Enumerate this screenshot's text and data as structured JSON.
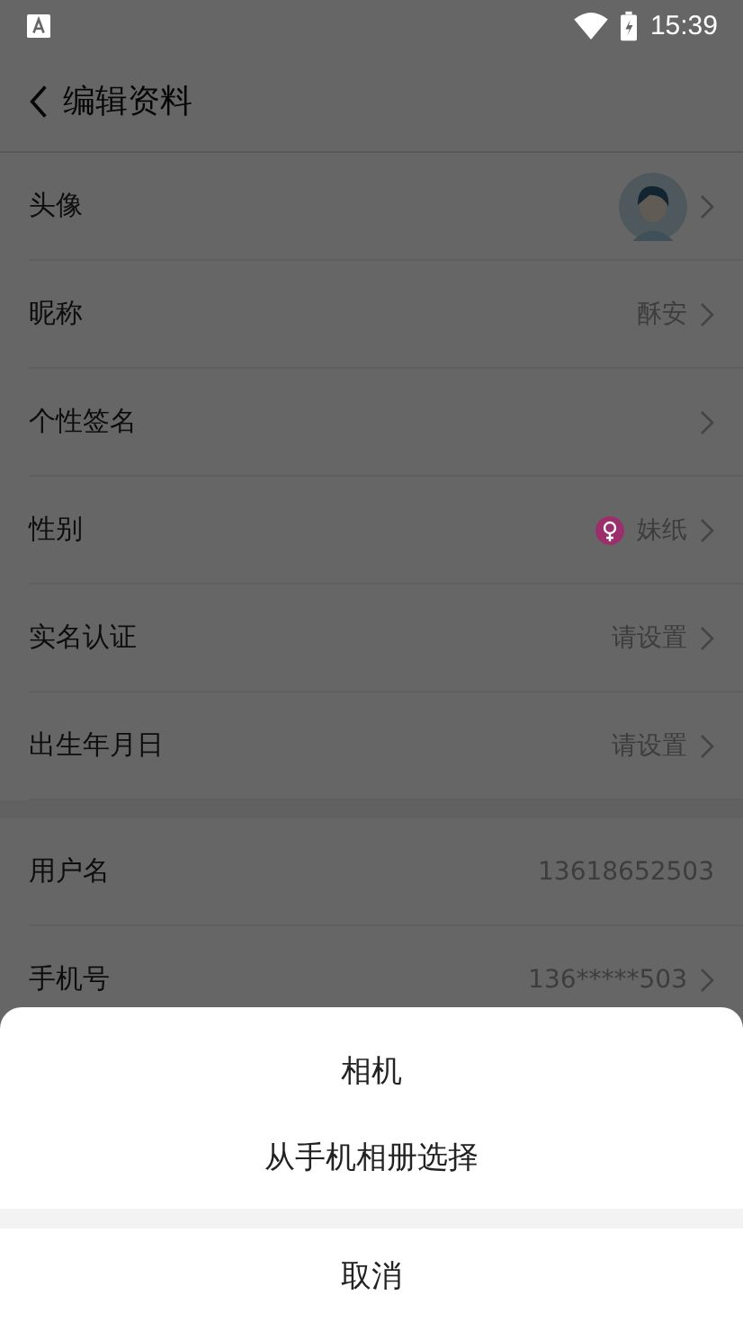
{
  "status_bar": {
    "time": "15:39"
  },
  "header": {
    "title": "编辑资料"
  },
  "sections": [
    {
      "rows": [
        {
          "kind": "avatar",
          "label": "头像",
          "arrow": true
        },
        {
          "kind": "text",
          "label": "昵称",
          "value": "酥安",
          "arrow": true
        },
        {
          "kind": "text",
          "label": "个性签名",
          "arrow": true
        },
        {
          "kind": "gender",
          "label": "性别",
          "value": "妹纸",
          "color": "#9b2f6b",
          "arrow": true
        },
        {
          "kind": "text",
          "label": "实名认证",
          "value": "请设置",
          "arrow": true
        },
        {
          "kind": "text",
          "label": "出生年月日",
          "value": "请设置",
          "arrow": true
        }
      ]
    },
    {
      "rows": [
        {
          "kind": "text",
          "label": "用户名",
          "value": "13618652503",
          "arrow": false
        },
        {
          "kind": "text",
          "label": "手机号",
          "value": "136*****503",
          "arrow": true
        }
      ]
    }
  ],
  "action_sheet": {
    "options": [
      "相机",
      "从手机相册选择"
    ],
    "cancel": "取消"
  }
}
